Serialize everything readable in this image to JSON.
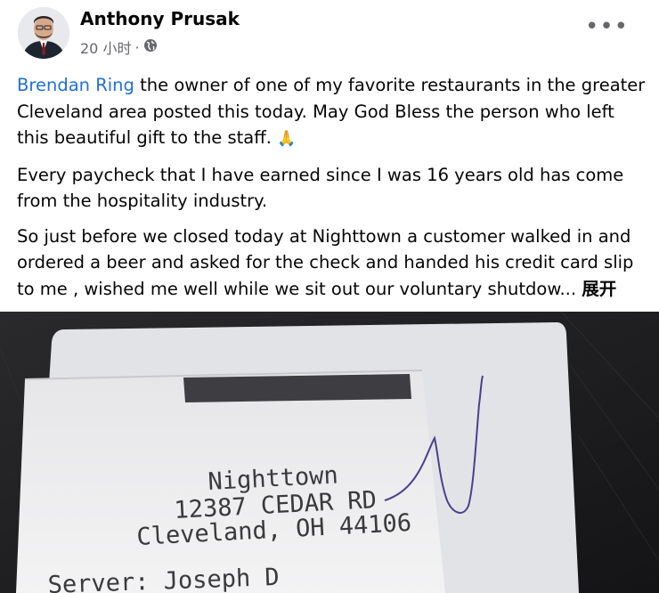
{
  "post": {
    "author": "Anthony Prusak",
    "time": "20 小时",
    "separator": "·",
    "privacy_icon": "public-globe-icon",
    "more_label": "•••",
    "paragraph1": {
      "mention": "Brendan Ring",
      "text": " the owner of one of my favorite restaurants in the greater Cleveland area posted this today. May God Bless the person who left this beautiful gift to the staff.",
      "emoji": "🙏"
    },
    "paragraph2": "Every paycheck that I have earned since I was 16 years old has come from the hospitality industry.",
    "paragraph3": "So just before we closed today at Nighttown a customer walked in and ordered a beer and asked for the check and handed his credit card slip to me , wished me well while we sit out our voluntary shutdow...",
    "see_more": "展开"
  },
  "receipt": {
    "name": "Nighttown",
    "address": "12387 CEDAR RD",
    "city": "Cleveland, OH 44106",
    "server": "Server: Joseph D"
  },
  "colors": {
    "link": "#216fdb",
    "meta": "#65676b",
    "text": "#050505"
  }
}
